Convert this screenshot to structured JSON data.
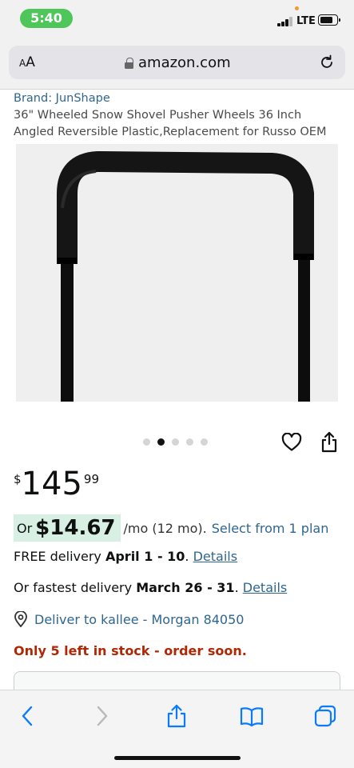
{
  "status_bar": {
    "time": "5:40",
    "network": "LTE",
    "signal_bars": 3,
    "battery_level": 0.7
  },
  "browser": {
    "text_size_button": "AA",
    "url": "amazon.com",
    "lock_icon": "lock-icon",
    "reload_icon": "reload-icon"
  },
  "product": {
    "brand": "Brand: JunShape",
    "title": "36\" Wheeled Snow Shovel Pusher Wheels 36 Inch Angled Reversible Plastic,Replacement for Russo OEM",
    "image_description_icon": "product-image",
    "image_dots": {
      "count": 5,
      "active_index": 1
    },
    "price": {
      "symbol": "$",
      "whole": "145",
      "fraction": "99"
    },
    "installment": {
      "prefix": "Or",
      "amount": "$14.67",
      "suffix": "/mo (12 mo).",
      "link": "Select from 1 plan",
      "highlight_color": "#d8f0e4"
    },
    "free_delivery": {
      "text": "FREE delivery ",
      "dates": "April 1 - 10",
      "period": ".",
      "link": "Details"
    },
    "fastest_delivery": {
      "text": "Or fastest delivery ",
      "dates": "March 26 - 31",
      "period": ".",
      "link": "Details"
    },
    "deliver_to": "Deliver to kallee - Morgan 84050",
    "stock": "Only 5 left in stock - order soon.",
    "stock_color": "#b12704",
    "link_color": "#2f6690"
  },
  "toolbar": {
    "back_icon": "back-icon",
    "forward_icon": "forward-icon",
    "share_icon": "share-icon",
    "bookmarks_icon": "bookmarks-icon",
    "tabs_icon": "tabs-icon",
    "accent": "#0a7aff"
  }
}
